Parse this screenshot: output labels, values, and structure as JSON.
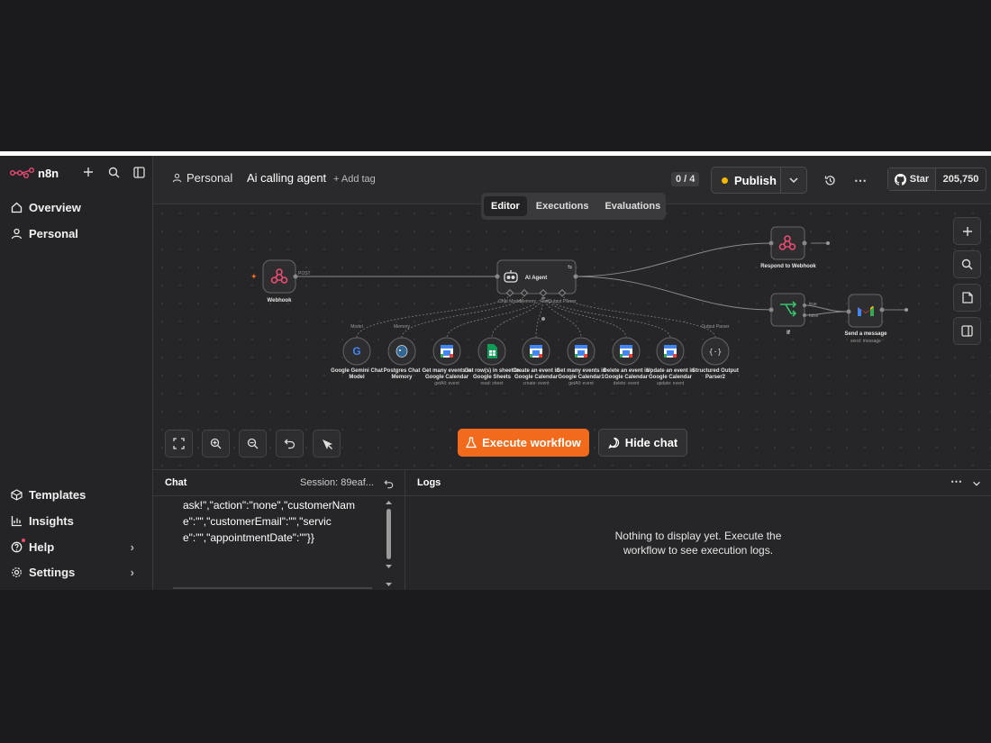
{
  "app": {
    "name": "n8n"
  },
  "sidebar": {
    "items": [
      {
        "label": "Overview"
      },
      {
        "label": "Personal"
      }
    ],
    "bottom_items": [
      {
        "label": "Templates"
      },
      {
        "label": "Insights"
      },
      {
        "label": "Help"
      },
      {
        "label": "Settings"
      }
    ]
  },
  "header": {
    "project": "Personal",
    "workflow_name": "Ai calling agent",
    "add_tag": "+ Add tag",
    "counter": "0 / 4",
    "publish_label": "Publish",
    "github_star": "Star",
    "github_count": "205,750"
  },
  "tabs": [
    {
      "label": "Editor"
    },
    {
      "label": "Executions"
    },
    {
      "label": "Evaluations"
    }
  ],
  "nodes": {
    "webhook": {
      "label": "Webhook",
      "port": "POST"
    },
    "agent": {
      "label": "AI Agent",
      "ports": [
        "Chat Model",
        "Memory",
        "Tool",
        "Output Parser"
      ]
    },
    "respond": {
      "label": "Respond to Webhook"
    },
    "if": {
      "label": "If",
      "true": "true",
      "false": "false"
    },
    "gmail": {
      "label": "Send a message",
      "sub": "send: message"
    },
    "edge_labels": [
      "Model",
      "Memory",
      "Output Parser"
    ],
    "subnodes": [
      {
        "label1": "Google Gemini Chat",
        "label2": "Model",
        "sub": ""
      },
      {
        "label1": "Postgres Chat",
        "label2": "Memory",
        "sub": ""
      },
      {
        "label1": "Get many events in",
        "label2": "Google Calendar",
        "sub": "getAll: event"
      },
      {
        "label1": "Get row(s) in sheet in",
        "label2": "Google Sheets",
        "sub": "read: sheet"
      },
      {
        "label1": "Create an event in",
        "label2": "Google Calendar",
        "sub": "create: event"
      },
      {
        "label1": "Get many events in",
        "label2": "Google Calendar1",
        "sub": "getAll: event"
      },
      {
        "label1": "Delete an event in",
        "label2": "Google Calendar",
        "sub": "delete: event"
      },
      {
        "label1": "Update an event in",
        "label2": "Google Calendar",
        "sub": "update: event"
      },
      {
        "label1": "Structured Output",
        "label2": "Parser2",
        "sub": ""
      }
    ]
  },
  "canvas_buttons": {
    "execute": "Execute workflow",
    "hide_chat": "Hide chat"
  },
  "chat": {
    "title": "Chat",
    "session": "Session: 89eaf...",
    "message": "ask!\",\"action\":\"none\",\"customerName\":\"\",\"customerEmail\":\"\",\"service\":\"\",\"appointmentDate\":\"\"}}"
  },
  "logs": {
    "title": "Logs",
    "empty": "Nothing to display yet. Execute the workflow to see execution logs."
  },
  "colors": {
    "accent": "#f26b1d",
    "brand": "#ea4b71",
    "publish_dot": "#f5b800"
  }
}
